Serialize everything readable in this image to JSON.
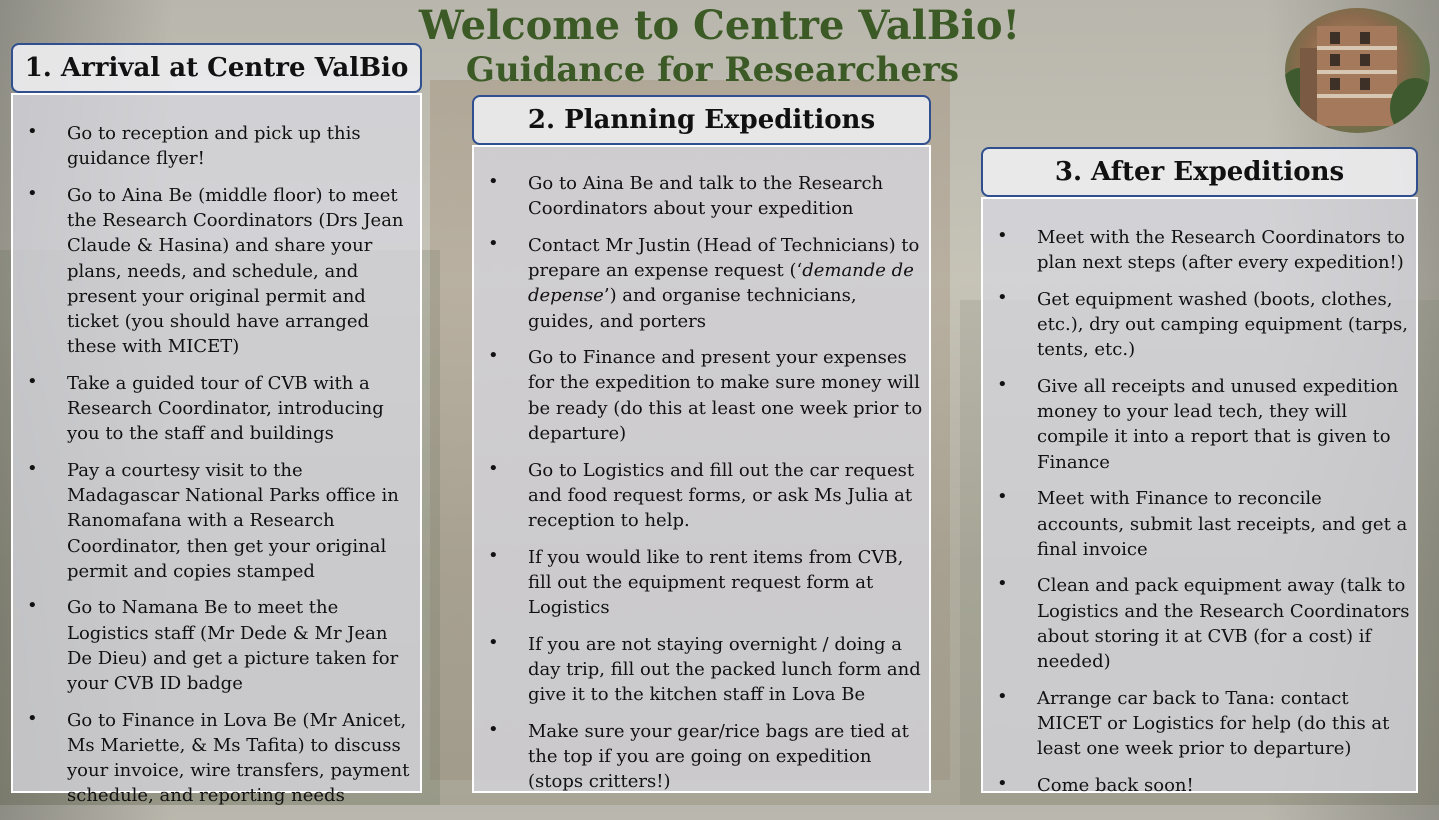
{
  "title": "Welcome to Centre ValBio!",
  "subtitle": "Guidance for Researchers",
  "sections": [
    {
      "heading": "1. Arrival at Centre ValBio",
      "items": [
        "Go to reception and pick up this guidance flyer!",
        "Go to Aina Be (middle floor) to meet the Research Coordinators (Drs Jean Claude & Hasina) and share your plans, needs, and schedule, and present your original permit and ticket (you should have arranged these with MICET)",
        "Take a guided tour of CVB with a Research Coordinator, introducing you to the staff and buildings",
        "Pay a courtesy visit to the Madagascar National Parks office in Ranomafana with a Research Coordinator, then get your original permit and copies stamped",
        "Go to Namana Be to meet the Logistics staff (Mr Dede & Mr Jean De Dieu) and get a picture taken for your CVB ID badge",
        "Go to Finance in Lova Be (Mr Anicet, Ms Mariette, & Ms Tafita) to discuss your invoice, wire transfers, payment schedule, and reporting needs"
      ]
    },
    {
      "heading": "2. Planning Expeditions",
      "items": [
        "Go to Aina Be and talk to the Research Coordinators about your expedition",
        {
          "before": "Contact Mr Justin (Head of Technicians) to prepare an expense request (‘",
          "italic": "demande de depense",
          "after": "’) and organise technicians, guides, and porters"
        },
        "Go to Finance and present your expenses for the expedition to make sure money will be ready (do this at least one week prior to departure)",
        "Go to Logistics and fill out the car request and food request forms, or ask Ms Julia at reception to help.",
        "If you would like to rent items from CVB, fill out the equipment request form at Logistics",
        "If you are not staying overnight / doing a day trip, fill out the packed lunch form and give it to the kitchen staff in Lova Be",
        "Make sure your gear/rice bags are tied at the top if you are going on expedition (stops critters!)"
      ]
    },
    {
      "heading": "3. After Expeditions",
      "items": [
        "Meet with the Research Coordinators to plan next steps (after every expedition!)",
        "Get equipment washed (boots, clothes, etc.), dry out camping equipment (tarps, tents, etc.)",
        "Give all receipts and unused expedition money to your lead tech, they will compile it into a report that is given to Finance",
        "Meet with Finance to reconcile accounts, submit last receipts, and get a final invoice",
        "Clean and pack equipment away (talk to Logistics and the Research Coordinators about storing it at CVB (for a cost) if needed)",
        "Arrange car back to Tana: contact MICET or Logistics for help (do this at least one week prior to departure)",
        "Come back soon!"
      ]
    }
  ],
  "bullet_char": "•",
  "colors": {
    "title": "#3c5a25",
    "header_border": "#2f4f8f",
    "panel_border": "#ffffff"
  }
}
